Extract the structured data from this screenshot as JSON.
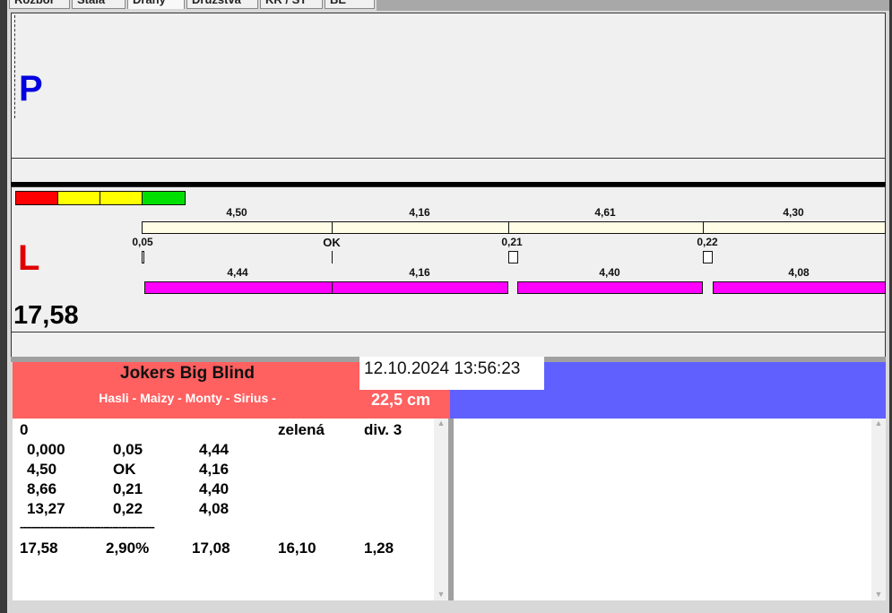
{
  "tabs": [
    "Rozbor",
    "Stala",
    "Dráhy",
    "Družstva",
    "KR / ST",
    "BE"
  ],
  "lanes": {
    "p_label": "P",
    "l_label": "L",
    "total": "17,58"
  },
  "status_colors": [
    "#ff0000",
    "#ffff00",
    "#ffff00",
    "#00e000"
  ],
  "top_values": [
    "4,50",
    "4,16",
    "4,61",
    "4,30"
  ],
  "marker_labels": [
    "0,05",
    "OK",
    "0,21",
    "0,22"
  ],
  "bottom_values": [
    "4,44",
    "4,16",
    "4,40",
    "4,08"
  ],
  "team": {
    "name": "Jokers Big Blind",
    "players": "Hasli - Maizy - Monty - Sirius -",
    "length": "22,5 cm",
    "datetime": "12.10.2024 13:56:23"
  },
  "results": {
    "header": [
      "0",
      "",
      "",
      "zelená",
      "div. 3"
    ],
    "rows": [
      [
        "0,000",
        "0,05",
        "4,44"
      ],
      [
        "4,50",
        "OK",
        "4,16"
      ],
      [
        "8,66",
        "0,21",
        "4,40"
      ],
      [
        "13,27",
        "0,22",
        "4,08"
      ]
    ],
    "separator": "---------------------------------------------",
    "totals": [
      "17,58",
      "2,90%",
      "17,08",
      "16,10",
      "1,28"
    ]
  },
  "colors": {
    "team_red": "#ff6060",
    "team_blue": "#6060ff",
    "magenta": "#ff00ff"
  }
}
